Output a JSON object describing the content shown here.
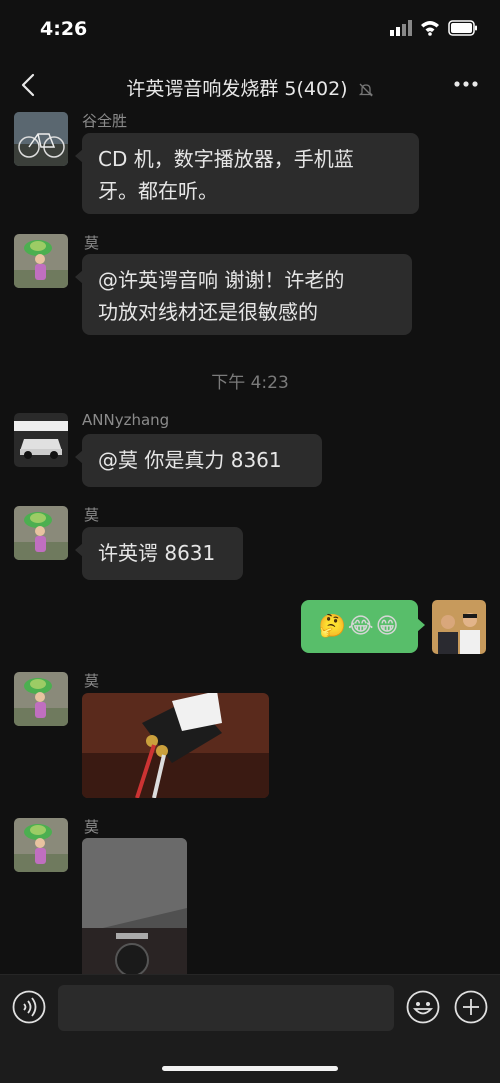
{
  "status": {
    "time": "4:26"
  },
  "header": {
    "title": "许英谔音响发烧群 5(402)"
  },
  "messages": [
    {
      "sender": "谷全胜",
      "text_lines": [
        "CD 机，数字播放器，手机蓝",
        "牙。都在听。"
      ]
    },
    {
      "sender": "莫",
      "text_lines": [
        "@许英谔音响 谢谢！许老的",
        "功放对线材还是很敏感的"
      ]
    },
    {
      "timestamp": "下午 4:23"
    },
    {
      "sender": "ANNyzhang",
      "text": "@莫 你是真力 8361"
    },
    {
      "sender": "莫",
      "text": "许英谔 8631"
    },
    {
      "sender": "me",
      "text": "🤔😂😁"
    },
    {
      "sender": "莫",
      "type": "image"
    },
    {
      "sender": "莫",
      "type": "image"
    }
  ],
  "colors": {
    "background": "#111111",
    "bubble": "#2c2c2c",
    "bubble_me": "#58be6a",
    "input_bar": "#1c1c1c"
  }
}
